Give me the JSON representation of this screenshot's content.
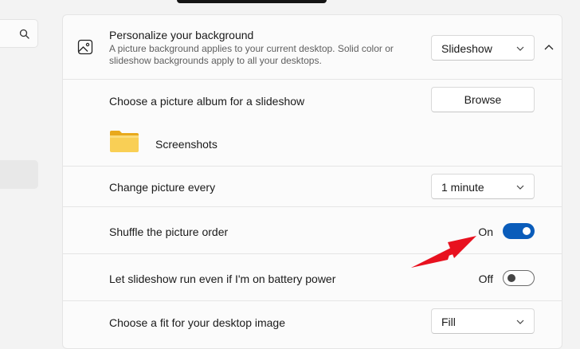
{
  "background_setting": {
    "title": "Personalize your background",
    "description": "A picture background applies to your current desktop. Solid color or slideshow backgrounds apply to all your desktops.",
    "mode_value": "Slideshow"
  },
  "album": {
    "label": "Choose a picture album for a slideshow",
    "browse_label": "Browse",
    "folder_name": "Screenshots"
  },
  "interval": {
    "label": "Change picture every",
    "value": "1 minute"
  },
  "shuffle": {
    "label": "Shuffle the picture order",
    "state": "On"
  },
  "battery": {
    "label": "Let slideshow run even if I'm on battery power",
    "state": "Off"
  },
  "fit": {
    "label": "Choose a fit for your desktop image",
    "value": "Fill"
  },
  "colors": {
    "accent": "#0a5cba",
    "annotation_arrow": "#e8111f",
    "folder": "#f7c84a"
  }
}
